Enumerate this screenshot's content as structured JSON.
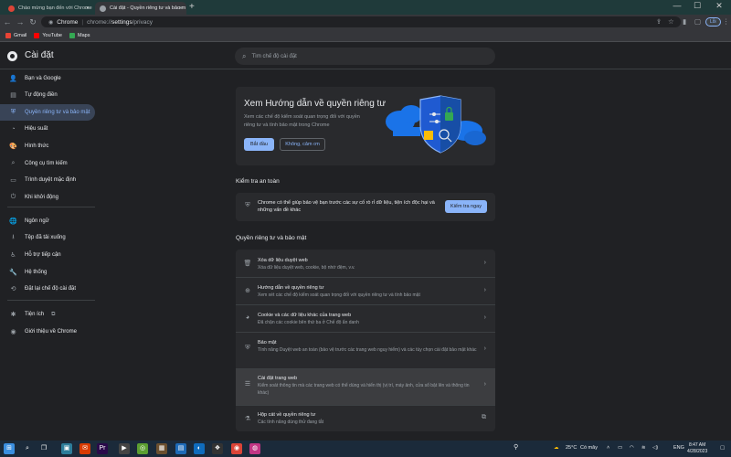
{
  "browser": {
    "tabs": [
      {
        "label": "Chào mừng bạn đến với Chrome",
        "active": false
      },
      {
        "label": "Cài đặt - Quyền riêng tư và bảo m",
        "active": true
      }
    ],
    "new_tab": "+",
    "nav": {
      "back": "←",
      "forward": "→",
      "reload": "↻"
    },
    "omnibox": {
      "site": "Chrome",
      "url_scheme": "chrome://",
      "url_path": "settings",
      "url_rest": "/privacy"
    },
    "profile_label": "Lỗi",
    "bookmarks": [
      {
        "label": "Gmail",
        "color": "#ea4335"
      },
      {
        "label": "YouTube",
        "color": "#ff0000"
      },
      {
        "label": "Maps",
        "color": "#34a853"
      }
    ],
    "window_controls": {
      "minimize": "—",
      "maximize": "☐",
      "close": "✕"
    }
  },
  "header": {
    "title": "Cài đặt",
    "search_placeholder": "Tìm chế độ cài đặt"
  },
  "sidebar": {
    "items": [
      {
        "label": "Bạn và Google",
        "icon": "person-icon",
        "glyph": "👤"
      },
      {
        "label": "Tự động điền",
        "icon": "autofill-icon",
        "glyph": "▤"
      },
      {
        "label": "Quyền riêng tư và bảo mật",
        "icon": "shield-icon",
        "glyph": "⛨",
        "selected": true
      },
      {
        "label": "Hiệu suất",
        "icon": "speed-icon",
        "glyph": "◔"
      },
      {
        "label": "Hình thức",
        "icon": "palette-icon",
        "glyph": "🎨"
      },
      {
        "label": "Công cụ tìm kiếm",
        "icon": "search-icon",
        "glyph": "⌕"
      },
      {
        "label": "Trình duyệt mặc định",
        "icon": "browser-icon",
        "glyph": "▭"
      },
      {
        "label": "Khi khởi động",
        "icon": "power-icon",
        "glyph": "⏻"
      },
      {
        "label": "Ngôn ngữ",
        "icon": "globe-icon",
        "glyph": "🌐"
      },
      {
        "label": "Tệp đã tải xuống",
        "icon": "download-icon",
        "glyph": "⭳"
      },
      {
        "label": "Hỗ trợ tiếp cận",
        "icon": "accessibility-icon",
        "glyph": "♿"
      },
      {
        "label": "Hệ thống",
        "icon": "wrench-icon",
        "glyph": "🔧"
      },
      {
        "label": "Đặt lại chế độ cài đặt",
        "icon": "reset-icon",
        "glyph": "⟲"
      },
      {
        "label": "Tiện ích",
        "icon": "puzzle-icon",
        "glyph": "✱",
        "external": "⧉"
      },
      {
        "label": "Giới thiệu về Chrome",
        "icon": "chrome-icon",
        "glyph": "◉"
      }
    ]
  },
  "guide_card": {
    "title": "Xem Hướng dẫn về quyền riêng tư",
    "description": "Xem các chế độ kiểm soát quan trọng đối với quyền riêng tư và tính bảo mật trong Chrome",
    "start_label": "Bắt đầu",
    "dismiss_label": "Không, cảm ơn"
  },
  "safety_check": {
    "section_title": "Kiểm tra an toàn",
    "text": "Chrome có thể giúp bảo vệ bạn trước các sự cố rò rỉ dữ liệu, tiện ích độc hại và những vấn đề khác",
    "button_label": "Kiểm tra ngay"
  },
  "privacy_section": {
    "section_title": "Quyền riêng tư và bảo mật",
    "rows": [
      {
        "title": "Xóa dữ liệu duyệt web",
        "subtitle": "Xóa dữ liệu duyệt web, cookie, bộ nhớ đệm, v.v.",
        "icon": "trash-icon",
        "glyph": "🗑",
        "action": "›"
      },
      {
        "title": "Hướng dẫn về quyền riêng tư",
        "subtitle": "Xem xét các chế độ kiểm soát quan trọng đối với quyền riêng tư và tính bảo mật",
        "icon": "add-circle-icon",
        "glyph": "⊕",
        "action": "›"
      },
      {
        "title": "Cookie và các dữ liệu khác của trang web",
        "subtitle": "Đã chặn các cookie bên thứ ba ở Chế độ ẩn danh",
        "icon": "cookie-icon",
        "glyph": "◕",
        "action": "›"
      },
      {
        "title": "Bảo mật",
        "subtitle": "Tính năng Duyệt web an toàn (bảo vệ trước các trang web nguy hiểm) và các tùy chọn cài đặt bảo mật khác",
        "icon": "security-shield-icon",
        "glyph": "⛨",
        "action": "›"
      },
      {
        "title": "Cài đặt trang web",
        "subtitle": "Kiểm soát thông tin mà các trang web có thể dùng và hiển thị (vị trí, máy ảnh, cửa sổ bật lên và thông tin khác)",
        "icon": "tune-icon",
        "glyph": "☰",
        "action": "›",
        "highlighted": true
      },
      {
        "title": "Hộp cát về quyền riêng tư",
        "subtitle": "Các tính năng dùng thử đang tắt",
        "icon": "flask-icon",
        "glyph": "⚗",
        "action": "⧉"
      }
    ]
  },
  "taskbar": {
    "weather": "25°C",
    "weather_desc": "Có mây",
    "language": "ENG",
    "time": "8:47 AM",
    "date": "4/28/2023",
    "apps": [
      {
        "name": "windows-start-icon",
        "glyph": "⊞",
        "color": "#3b8fe0"
      },
      {
        "name": "search-icon",
        "glyph": "⌕",
        "color": "transparent"
      },
      {
        "name": "task-view-icon",
        "glyph": "❐",
        "color": "transparent"
      },
      {
        "name": "app-icon-1",
        "glyph": "▣",
        "color": "#2d7d9a"
      },
      {
        "name": "app-icon-2",
        "glyph": "✉",
        "color": "#d83b01"
      },
      {
        "name": "app-icon-3",
        "glyph": "Pr",
        "color": "#2a0a4a"
      },
      {
        "name": "app-icon-4",
        "glyph": "▶",
        "color": "#444"
      },
      {
        "name": "app-icon-5",
        "glyph": "◎",
        "color": "#5c9e31"
      },
      {
        "name": "app-icon-6",
        "glyph": "▦",
        "color": "#6b4f2f"
      },
      {
        "name": "app-icon-7",
        "glyph": "▤",
        "color": "#1e6bb8"
      },
      {
        "name": "edge-icon",
        "glyph": "◐",
        "color": "#0f6cbd"
      },
      {
        "name": "app-icon-8",
        "glyph": "❖",
        "color": "#333"
      },
      {
        "name": "chrome-icon",
        "glyph": "◉",
        "color": "#db4437"
      },
      {
        "name": "app-icon-9",
        "glyph": "◍",
        "color": "#c13584"
      }
    ]
  },
  "colors": {
    "accent": "#8ab4f8",
    "background": "#202124",
    "card": "#292a2d",
    "selected_nav": "#394457"
  }
}
